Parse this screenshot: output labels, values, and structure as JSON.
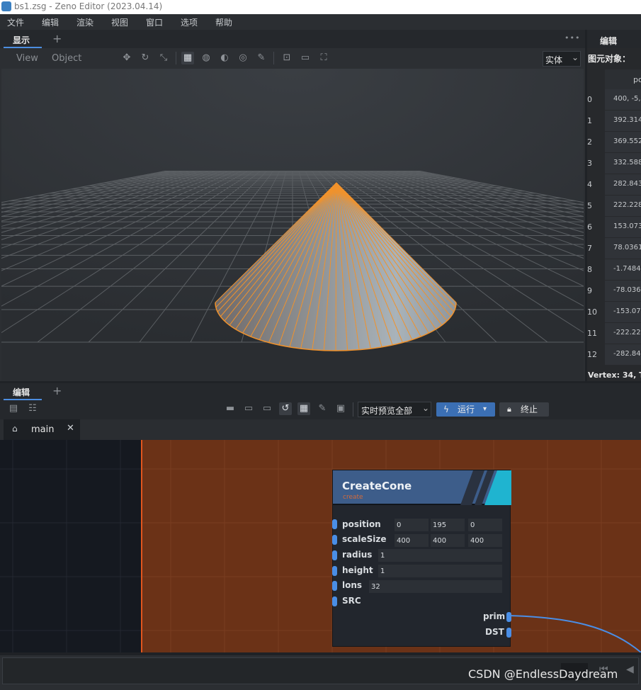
{
  "window": {
    "title": "bs1.zsg - Zeno Editor (2023.04.14)"
  },
  "menu": [
    "文件",
    "编辑",
    "渲染",
    "视图",
    "窗口",
    "选项",
    "帮助"
  ],
  "viewport_panel": {
    "tab_label": "显示",
    "add_tab": "+",
    "more": "•••",
    "menu_view": "View",
    "menu_object": "Object",
    "render_mode": "实体",
    "render_mode_arrow": "⌄"
  },
  "spreadsheet": {
    "tab_label": "编辑",
    "object_label": "图元对象：",
    "column_header": "po",
    "rows": [
      {
        "index": "0",
        "value": "400, -5,"
      },
      {
        "index": "1",
        "value": "392.314"
      },
      {
        "index": "2",
        "value": "369.552"
      },
      {
        "index": "3",
        "value": "332.588"
      },
      {
        "index": "4",
        "value": "282.843"
      },
      {
        "index": "5",
        "value": "222.228"
      },
      {
        "index": "6",
        "value": "153.073"
      },
      {
        "index": "7",
        "value": "78.0361"
      },
      {
        "index": "8",
        "value": "-1.7484"
      },
      {
        "index": "9",
        "value": "-78.036"
      },
      {
        "index": "10",
        "value": "-153.07"
      },
      {
        "index": "11",
        "value": "-222.22"
      },
      {
        "index": "12",
        "value": "-282.84"
      }
    ],
    "footer": "Vertex: 34, T"
  },
  "editor_panel": {
    "tab_label": "编辑",
    "add_tab": "+",
    "preview_select": "实时预览全部",
    "preview_arrow": "⌄",
    "run_label": "运行",
    "run_arrow": "▾",
    "stop_label": "终止",
    "subgraph_tab": "main",
    "close_glyph": "✕"
  },
  "node": {
    "title": "CreateCone",
    "subtitle": "create",
    "params": [
      {
        "label": "position",
        "values": [
          "0",
          "195",
          "0"
        ]
      },
      {
        "label": "scaleSize",
        "values": [
          "400",
          "400",
          "400"
        ]
      },
      {
        "label": "radius",
        "values": [
          "1"
        ]
      },
      {
        "label": "height",
        "values": [
          "1"
        ]
      },
      {
        "label": "lons",
        "values": [
          "32"
        ]
      },
      {
        "label": "SRC",
        "values": []
      }
    ],
    "outputs": [
      "prim",
      "DST"
    ]
  },
  "watermark": "CSDN @EndlessDaydream",
  "colors": {
    "accent_blue": "#4a8ee6",
    "cone_edge": "#f0922c",
    "graph_bg": "#6b3217",
    "node_header": "#3d5d8a",
    "node_stripe": "#1fb4d0"
  }
}
